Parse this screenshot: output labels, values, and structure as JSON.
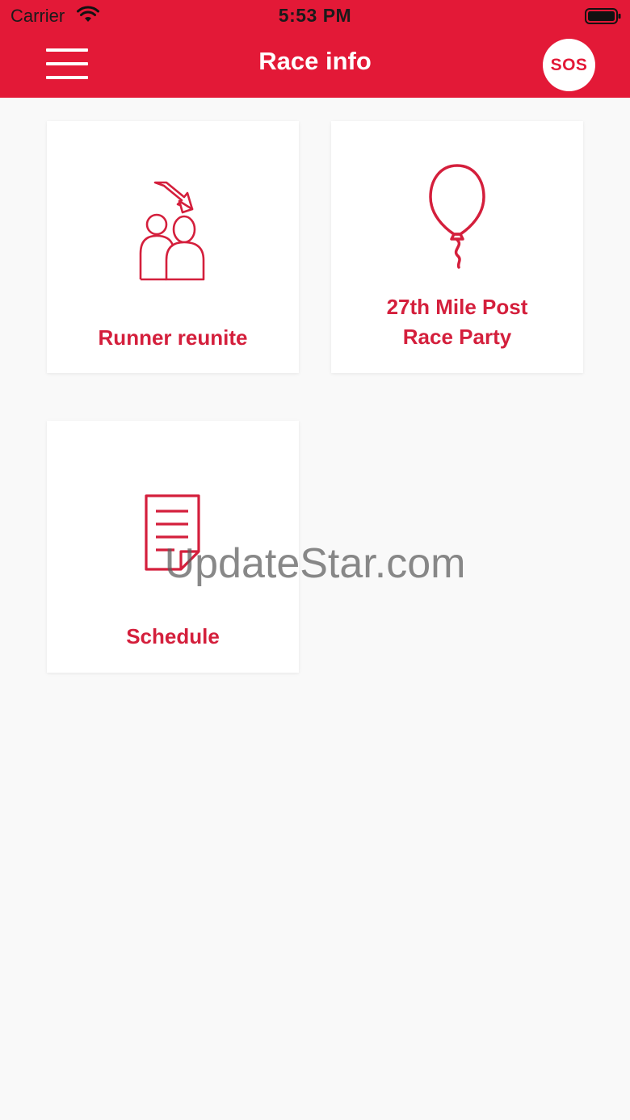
{
  "status_bar": {
    "carrier": "Carrier",
    "time": "5:53 PM",
    "wifi_icon": "wifi-icon",
    "battery_icon": "battery-icon"
  },
  "header": {
    "title": "Race info",
    "menu_icon": "hamburger-menu-icon",
    "sos_label": "SOS",
    "background_color": "#e31937"
  },
  "tiles": [
    {
      "label": "Runner reunite",
      "icon": "runner-reunite-icon"
    },
    {
      "label_line1": "27th Mile Post",
      "label_line2": "Race Party",
      "icon": "balloon-icon"
    },
    {
      "label": "Schedule",
      "icon": "document-icon"
    }
  ],
  "accent_color": "#d41f3c",
  "watermark": "UpdateStar.com"
}
